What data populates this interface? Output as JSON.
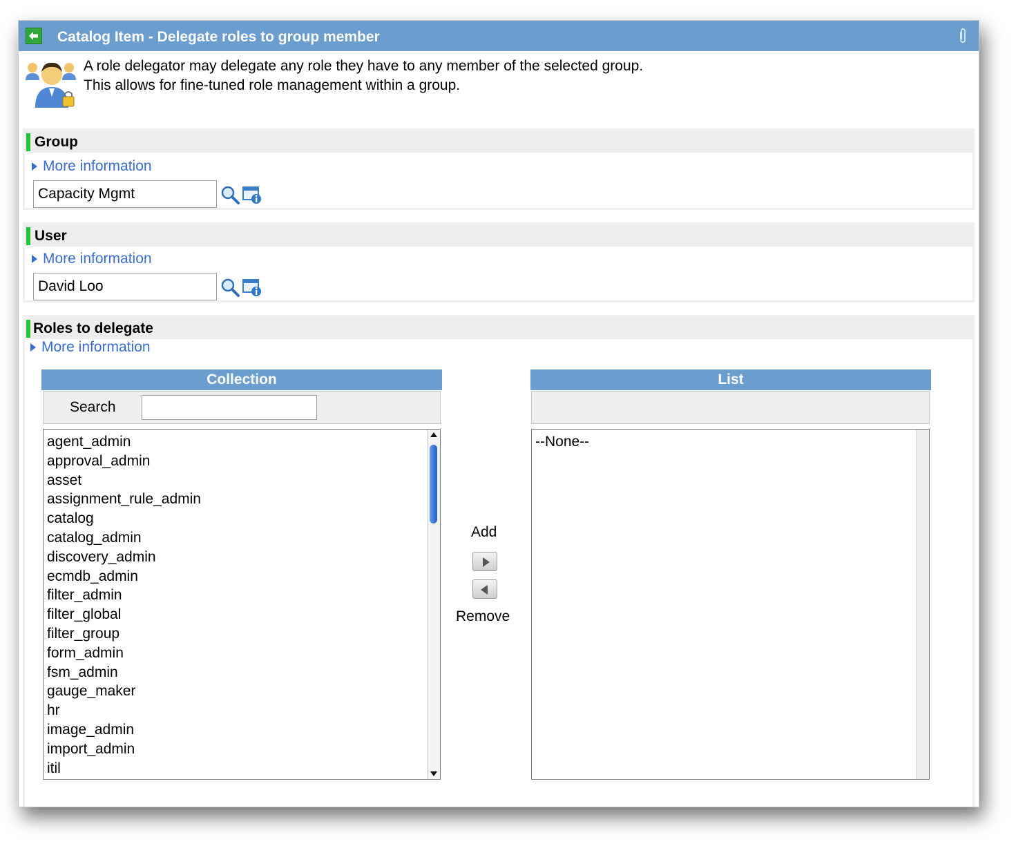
{
  "window": {
    "title": "Catalog Item - Delegate roles to group member"
  },
  "intro": {
    "line1": "A role delegator may delegate any role they have to any member of the selected group.",
    "line2": "This allows for fine-tuned role management within a group."
  },
  "group": {
    "label": "Group",
    "more_info": "More information",
    "value": "Capacity Mgmt"
  },
  "user": {
    "label": "User",
    "more_info": "More information",
    "value": "David Loo"
  },
  "roles": {
    "label": "Roles to delegate",
    "more_info": "More information",
    "collection_header": "Collection",
    "list_header": "List",
    "search_label": "Search",
    "search_value": "",
    "collection_items": [
      "agent_admin",
      "approval_admin",
      "asset",
      "assignment_rule_admin",
      "catalog",
      "catalog_admin",
      "discovery_admin",
      "ecmdb_admin",
      "filter_admin",
      "filter_global",
      "filter_group",
      "form_admin",
      "fsm_admin",
      "gauge_maker",
      "hr",
      "image_admin",
      "import_admin",
      "itil"
    ],
    "list_items": [
      "--None--"
    ],
    "add_label": "Add",
    "remove_label": "Remove"
  },
  "colors": {
    "header_blue": "#6c9dcf",
    "link_blue": "#3b6dd1",
    "mandatory_green": "#22c53a",
    "section_gray": "#ededed"
  },
  "icons": {
    "back": "back-arrow-icon",
    "attachment": "paperclip-icon",
    "intro": "users-lock-icon",
    "lookup": "magnifier-icon",
    "reference_info": "reference-info-icon"
  }
}
